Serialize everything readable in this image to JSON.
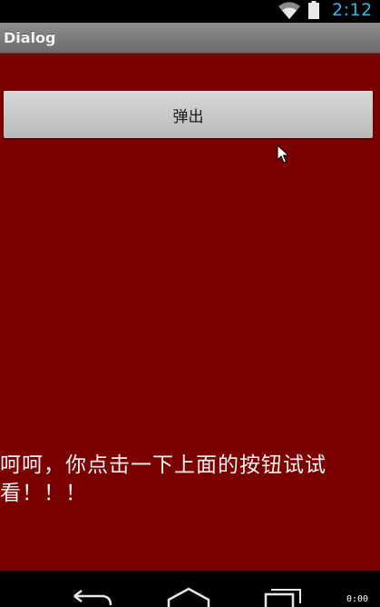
{
  "status_bar": {
    "time": "2:12",
    "accent_color": "#33b5e5",
    "icons": [
      "wifi-icon",
      "battery-icon"
    ]
  },
  "app": {
    "title": "Dialog",
    "background_color": "#7b0000"
  },
  "main": {
    "popup_button_label": "弹出",
    "hint_text": "呵呵，你点击一下上面的按钮试试看！！！"
  },
  "nav_bar": {
    "buttons": [
      "back-icon",
      "home-icon",
      "recent-apps-icon"
    ]
  },
  "overlay": {
    "corner_label": "0:00"
  }
}
